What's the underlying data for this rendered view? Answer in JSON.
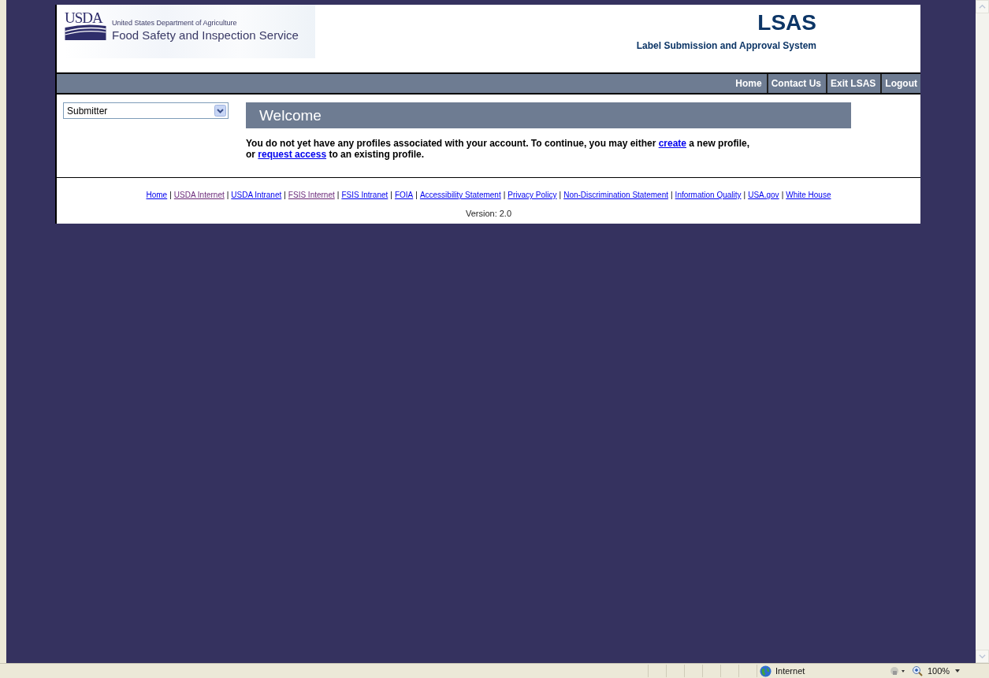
{
  "header": {
    "agency": "United States Department of Agriculture",
    "service": "Food Safety and Inspection Service",
    "logo_text": "USDA",
    "app_name": "LSAS",
    "app_subtitle": "Label Submission and Approval System"
  },
  "nav": [
    {
      "label": "Home"
    },
    {
      "label": "Contact Us"
    },
    {
      "label": "Exit LSAS"
    },
    {
      "label": "Logout"
    }
  ],
  "role_select": {
    "value": "Submitter"
  },
  "welcome": {
    "title": "Welcome",
    "parts": [
      {
        "kind": "text",
        "text": "You do not yet have any profiles associated with your account. To continue, you may either "
      },
      {
        "kind": "link",
        "text": "create"
      },
      {
        "kind": "text",
        "text": " a new profile,"
      },
      {
        "kind": "break"
      },
      {
        "kind": "text",
        "text": "or "
      },
      {
        "kind": "link",
        "text": "request access"
      },
      {
        "kind": "text",
        "text": " to an existing profile."
      }
    ]
  },
  "footer": {
    "links": [
      {
        "label": "Home",
        "visited": false
      },
      {
        "label": "USDA Internet",
        "visited": true
      },
      {
        "label": "USDA Intranet",
        "visited": false
      },
      {
        "label": "FSIS Internet",
        "visited": true
      },
      {
        "label": "FSIS Intranet",
        "visited": false
      },
      {
        "label": "FOIA",
        "visited": false
      },
      {
        "label": "Accessibility Statement",
        "visited": false
      },
      {
        "label": "Privacy Policy",
        "visited": false
      },
      {
        "label": "Non-Discrimination Statement",
        "visited": false
      },
      {
        "label": "Information Quality",
        "visited": false
      },
      {
        "label": "USA.gov",
        "visited": false
      },
      {
        "label": "White House",
        "visited": false
      }
    ],
    "separator": "|",
    "version": "Version: 2.0"
  },
  "status_bar": {
    "zone": "Internet",
    "zoom": "100%"
  }
}
